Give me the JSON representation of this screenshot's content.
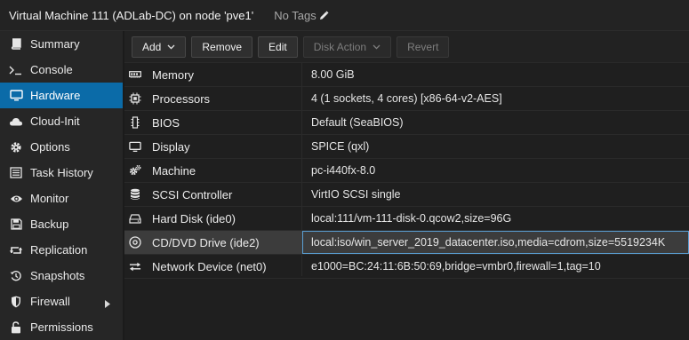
{
  "title": {
    "vm": "Virtual Machine 111 (ADLab-DC) on node 'pve1'",
    "tags": "No Tags"
  },
  "sidebar": {
    "items": [
      {
        "label": "Summary",
        "icon": "book-icon"
      },
      {
        "label": "Console",
        "icon": "terminal-icon"
      },
      {
        "label": "Hardware",
        "icon": "monitor-icon",
        "active": true
      },
      {
        "label": "Cloud-Init",
        "icon": "cloud-icon"
      },
      {
        "label": "Options",
        "icon": "gear-icon"
      },
      {
        "label": "Task History",
        "icon": "list-icon"
      },
      {
        "label": "Monitor",
        "icon": "eye-icon"
      },
      {
        "label": "Backup",
        "icon": "floppy-icon"
      },
      {
        "label": "Replication",
        "icon": "retweet-icon"
      },
      {
        "label": "Snapshots",
        "icon": "history-icon"
      },
      {
        "label": "Firewall",
        "icon": "shield-icon"
      },
      {
        "label": "Permissions",
        "icon": "unlock-icon"
      }
    ]
  },
  "toolbar": {
    "add": "Add",
    "remove": "Remove",
    "edit": "Edit",
    "disk_action": "Disk Action",
    "revert": "Revert"
  },
  "hardware": [
    {
      "name": "Memory",
      "value": "8.00 GiB",
      "icon": "memory-icon"
    },
    {
      "name": "Processors",
      "value": "4 (1 sockets, 4 cores) [x86-64-v2-AES]",
      "icon": "cpu-icon"
    },
    {
      "name": "BIOS",
      "value": "Default (SeaBIOS)",
      "icon": "bios-chip-icon"
    },
    {
      "name": "Display",
      "value": "SPICE (qxl)",
      "icon": "display-icon"
    },
    {
      "name": "Machine",
      "value": "pc-i440fx-8.0",
      "icon": "cogs-icon"
    },
    {
      "name": "SCSI Controller",
      "value": "VirtIO SCSI single",
      "icon": "database-icon"
    },
    {
      "name": "Hard Disk (ide0)",
      "value": "local:111/vm-111-disk-0.qcow2,size=96G",
      "icon": "harddisk-icon"
    },
    {
      "name": "CD/DVD Drive (ide2)",
      "value": "local:iso/win_server_2019_datacenter.iso,media=cdrom,size=5519234K",
      "icon": "cdrom-icon",
      "selected": true
    },
    {
      "name": "Network Device (net0)",
      "value": "e1000=BC:24:11:6B:50:69,bridge=vmbr0,firewall=1,tag=10",
      "icon": "exchange-icon"
    }
  ],
  "colors": {
    "accent": "#0b6ba8",
    "selection_border": "#5a9fd3",
    "background": "#1b1b1b"
  }
}
